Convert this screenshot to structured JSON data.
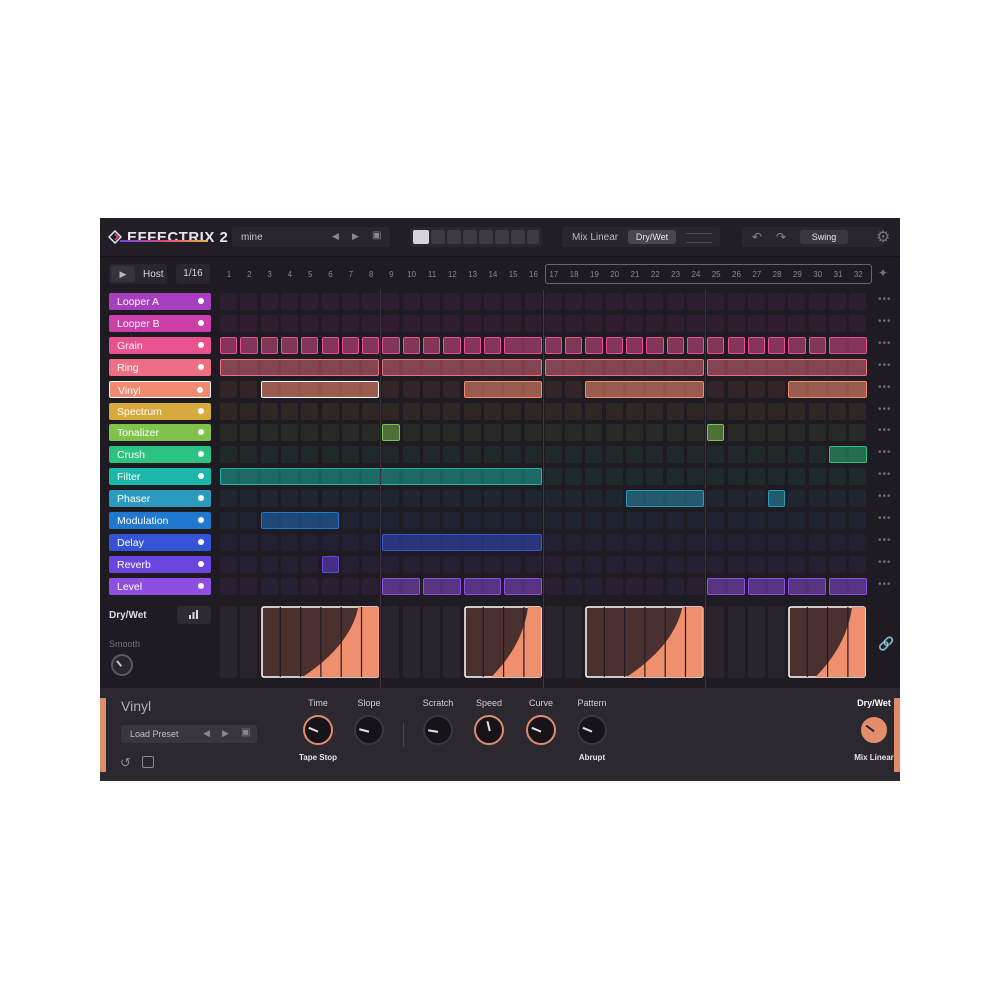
{
  "app": {
    "title": "EFFECTRIX 2"
  },
  "header": {
    "preset_name": "mine",
    "mix_mode": "Mix Linear",
    "mix_target": "Dry/Wet",
    "swing_label": "Swing"
  },
  "transport": {
    "sync_label": "Host",
    "division": "1/16"
  },
  "steps": [
    "1",
    "2",
    "3",
    "4",
    "5",
    "6",
    "7",
    "8",
    "9",
    "10",
    "11",
    "12",
    "13",
    "14",
    "15",
    "16",
    "17",
    "18",
    "19",
    "20",
    "21",
    "22",
    "23",
    "24",
    "25",
    "26",
    "27",
    "28",
    "29",
    "30",
    "31",
    "32"
  ],
  "effects": [
    {
      "label": "Looper A",
      "color": "#a73fc0"
    },
    {
      "label": "Looper B",
      "color": "#cc3fa9"
    },
    {
      "label": "Grain",
      "color": "#e8528d"
    },
    {
      "label": "Ring",
      "color": "#ee6f83"
    },
    {
      "label": "Vinyl",
      "color": "#f08a70",
      "selected": true
    },
    {
      "label": "Spectrum",
      "color": "#d7aa3e"
    },
    {
      "label": "Tonalizer",
      "color": "#7fc34c"
    },
    {
      "label": "Crush",
      "color": "#2cc27f"
    },
    {
      "label": "Filter",
      "color": "#1bb7aa"
    },
    {
      "label": "Phaser",
      "color": "#2a9bbd"
    },
    {
      "label": "Modulation",
      "color": "#1f77cf"
    },
    {
      "label": "Delay",
      "color": "#3453d7"
    },
    {
      "label": "Reverb",
      "color": "#6a45e0"
    },
    {
      "label": "Level",
      "color": "#8f4ee2"
    }
  ],
  "pattern": [
    [],
    [],
    [
      [
        1,
        1
      ],
      [
        2,
        1
      ],
      [
        3,
        1
      ],
      [
        4,
        1
      ],
      [
        5,
        1
      ],
      [
        6,
        1
      ],
      [
        7,
        1
      ],
      [
        8,
        1
      ],
      [
        9,
        1
      ],
      [
        10,
        1
      ],
      [
        11,
        1
      ],
      [
        12,
        1
      ],
      [
        13,
        1
      ],
      [
        14,
        1
      ],
      [
        15,
        2
      ],
      [
        17,
        1
      ],
      [
        18,
        1
      ],
      [
        19,
        1
      ],
      [
        20,
        1
      ],
      [
        21,
        1
      ],
      [
        22,
        1
      ],
      [
        23,
        1
      ],
      [
        24,
        1
      ],
      [
        25,
        1
      ],
      [
        26,
        1
      ],
      [
        27,
        1
      ],
      [
        28,
        1
      ],
      [
        29,
        1
      ],
      [
        30,
        1
      ],
      [
        31,
        2
      ]
    ],
    [
      [
        1,
        8
      ],
      [
        9,
        8
      ],
      [
        17,
        8
      ],
      [
        25,
        8
      ]
    ],
    [
      [
        3,
        6
      ],
      [
        13,
        4
      ],
      [
        19,
        6
      ],
      [
        29,
        4
      ]
    ],
    [],
    [
      [
        9,
        1
      ],
      [
        25,
        1
      ]
    ],
    [
      [
        31,
        2
      ]
    ],
    [
      [
        1,
        16
      ]
    ],
    [
      [
        21,
        4
      ],
      [
        28,
        1
      ]
    ],
    [
      [
        3,
        4
      ]
    ],
    [
      [
        9,
        8
      ]
    ],
    [
      [
        6,
        1
      ]
    ],
    [
      [
        9,
        2
      ],
      [
        11,
        2
      ],
      [
        13,
        2
      ],
      [
        15,
        2
      ],
      [
        25,
        2
      ],
      [
        27,
        2
      ],
      [
        29,
        2
      ],
      [
        31,
        2
      ]
    ]
  ],
  "dry_wet": {
    "label": "Dry/Wet",
    "smooth_label": "Smooth",
    "segments": [
      [
        3,
        6
      ],
      [
        13,
        4
      ],
      [
        19,
        6
      ],
      [
        29,
        4
      ]
    ]
  },
  "panel": {
    "title": "Vinyl",
    "load_preset": "Load Preset",
    "knobs": [
      {
        "label": "Time",
        "sub": "Tape Stop",
        "value": 0.25,
        "accent": true
      },
      {
        "label": "Slope",
        "sub": "",
        "value": 0.22,
        "accent": false
      },
      {
        "label": "Scratch",
        "sub": "",
        "value": 0.2,
        "accent": false
      },
      {
        "label": "Speed",
        "sub": "",
        "value": 0.45,
        "accent": true
      },
      {
        "label": "Curve",
        "sub": "",
        "value": 0.25,
        "accent": true
      },
      {
        "label": "Pattern",
        "sub": "Abrupt",
        "value": 0.25,
        "accent": false
      }
    ],
    "dry_wet_label": "Dry/Wet",
    "dry_wet_mode": "Mix Linear",
    "dry_wet_value": 0.3
  }
}
